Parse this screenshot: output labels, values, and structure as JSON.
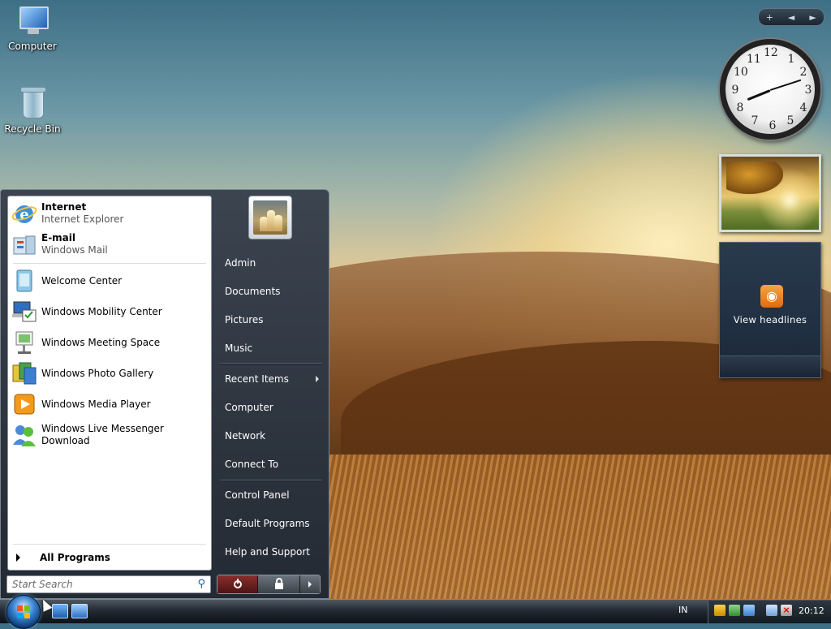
{
  "desktop": {
    "icons": [
      {
        "label": "Computer",
        "icon": "computer-icon"
      },
      {
        "label": "Recycle Bin",
        "icon": "recycle-bin-icon"
      }
    ]
  },
  "sidebar": {
    "controls": {
      "add": "+",
      "prev": "◄",
      "next": "►"
    },
    "clock": {
      "numbers": [
        "12",
        "1",
        "2",
        "3",
        "4",
        "5",
        "6",
        "7",
        "8",
        "9",
        "10",
        "11"
      ],
      "time_shown": "20:12"
    },
    "feeds": {
      "label": "View headlines",
      "icon": "rss-icon"
    }
  },
  "start_menu": {
    "pinned": [
      {
        "title": "Internet",
        "subtitle": "Internet Explorer",
        "icon": "internet-explorer-icon"
      },
      {
        "title": "E-mail",
        "subtitle": "Windows Mail",
        "icon": "windows-mail-icon"
      }
    ],
    "recent": [
      {
        "label": "Welcome Center",
        "icon": "welcome-center-icon"
      },
      {
        "label": "Windows Mobility Center",
        "icon": "mobility-center-icon"
      },
      {
        "label": "Windows Meeting Space",
        "icon": "meeting-space-icon"
      },
      {
        "label": "Windows Photo Gallery",
        "icon": "photo-gallery-icon"
      },
      {
        "label": "Windows Media Player",
        "icon": "media-player-icon"
      },
      {
        "label": "Windows Live Messenger Download",
        "icon": "messenger-icon"
      }
    ],
    "all_programs": "All Programs",
    "search_placeholder": "Start Search",
    "right_links": {
      "user": "Admin",
      "documents": "Documents",
      "pictures": "Pictures",
      "music": "Music",
      "recent_items": "Recent Items",
      "computer": "Computer",
      "network": "Network",
      "connect_to": "Connect To",
      "control_panel": "Control Panel",
      "default_programs": "Default Programs",
      "help_support": "Help and Support"
    }
  },
  "taskbar": {
    "language": "IN",
    "clock": "20:12"
  },
  "colors": {
    "start_menu_dark": "#232a33",
    "power_red": "#8a2d2d",
    "accent_blue": "#1f5aa8",
    "rss_orange": "#f08a2a"
  }
}
